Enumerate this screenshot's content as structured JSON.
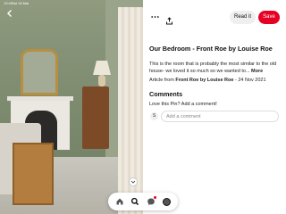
{
  "status_bar": {
    "time": "13:41",
    "date": "Sat 18 Mar",
    "right": ""
  },
  "icons": {
    "back": "chevron-left-icon",
    "more": "more-horizontal-icon",
    "share": "share-icon",
    "home": "home-icon",
    "search": "search-icon",
    "messages": "chat-icon",
    "profile": "avatar"
  },
  "colors": {
    "accent": "#e60023",
    "button_grey": "#efefef"
  },
  "topbar": {
    "read_it_label": "Read it",
    "save_label": "Save"
  },
  "pin": {
    "title": "Our Bedroom - Front Roe by Louise Roe",
    "description": "This is the room that is probably the most similar to the old house- we loved it so much so we wanted to...",
    "more_label": "More",
    "article_prefix": "Article from",
    "article_source": "Front Roe by Louise Roe",
    "article_sep": " - ",
    "article_date": "24 Nov 2021"
  },
  "comments": {
    "heading": "Comments",
    "prompt": "Love this Pin? Add a comment!",
    "avatar_letter": "S",
    "input_placeholder": "Add a comment"
  }
}
